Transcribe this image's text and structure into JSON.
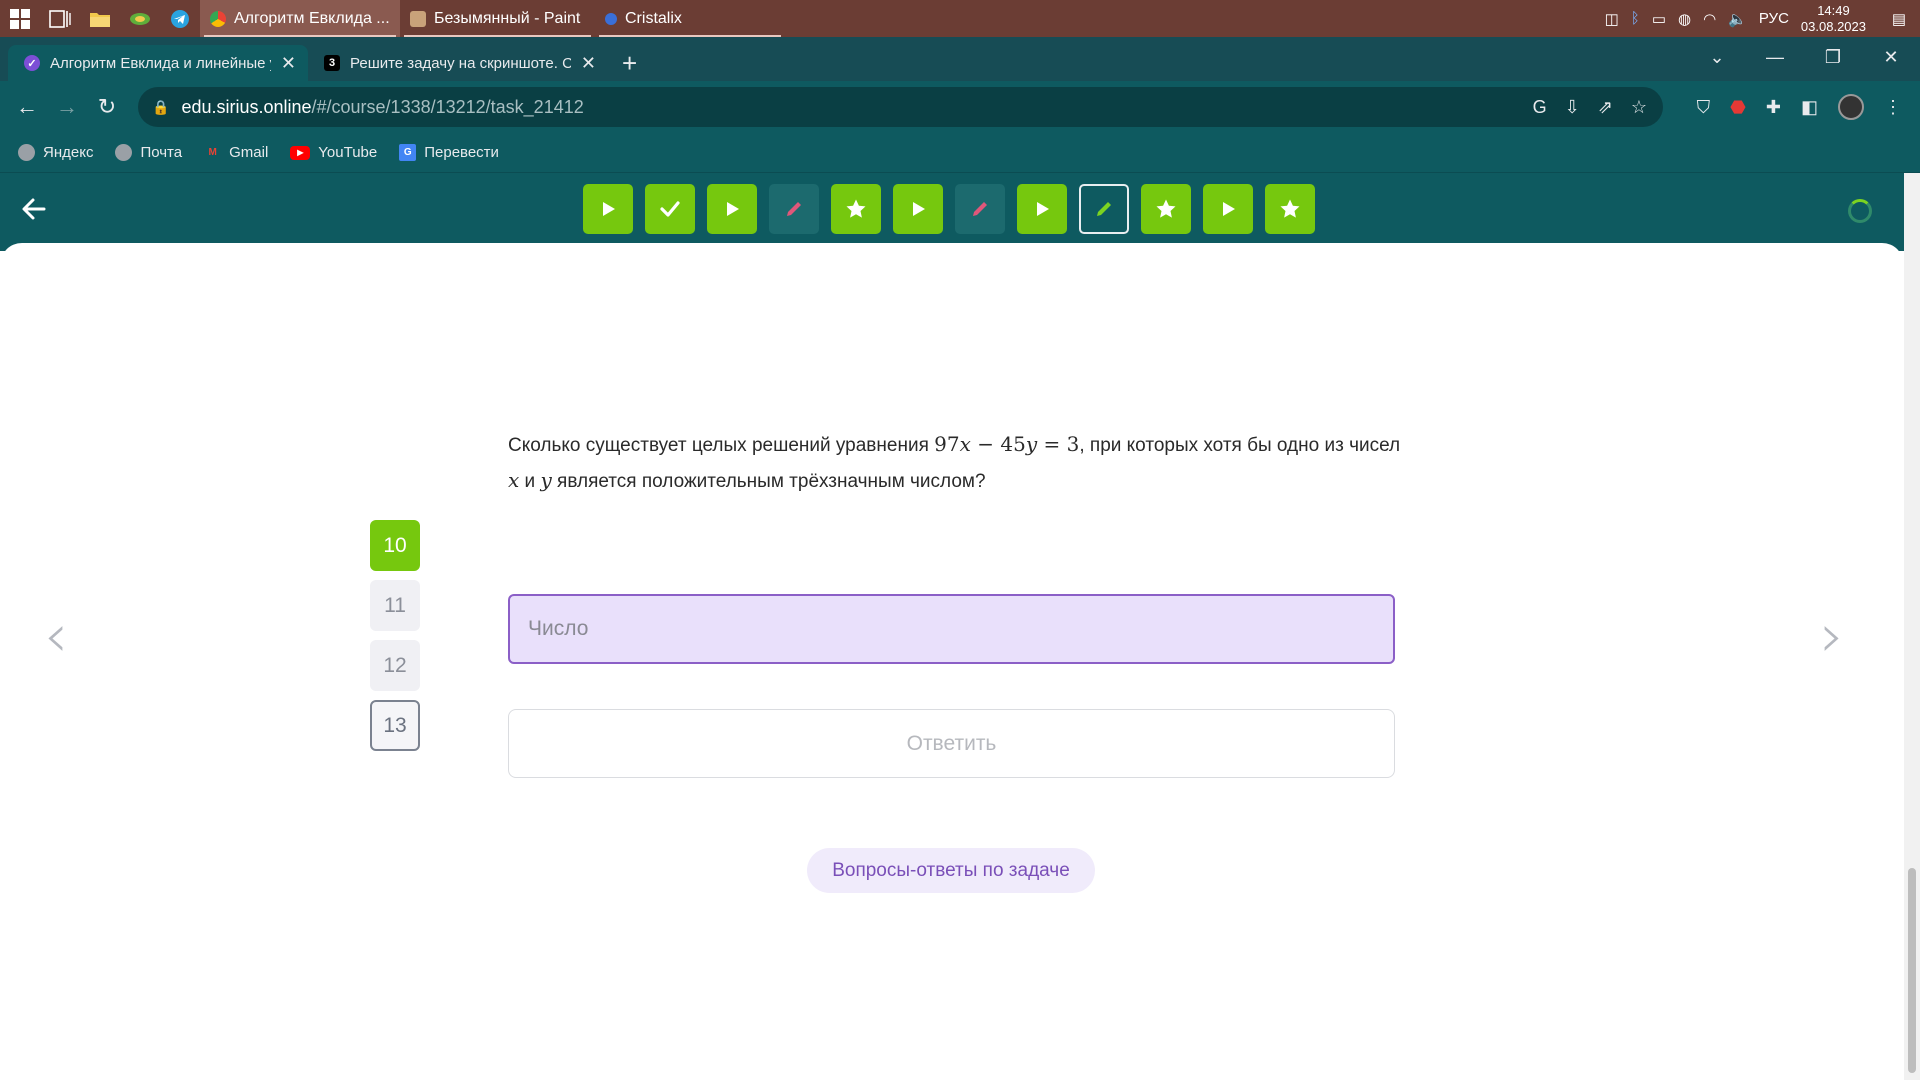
{
  "taskbar": {
    "items": [
      {
        "label": "Алгоритм Евклида ...",
        "icon": "chrome-icon"
      },
      {
        "label": "Безымянный - Paint",
        "icon": "paint-icon"
      },
      {
        "label": "Cristalix",
        "icon": "cristalix-icon"
      }
    ],
    "language": "РУС",
    "time": "14:49",
    "date": "03.08.2023"
  },
  "browser": {
    "tabs": [
      {
        "title": "Алгоритм Евклида и линейные у",
        "active": true
      },
      {
        "title": "Решите задачу на скриншоте. С",
        "active": false,
        "favicon_text": "3"
      }
    ],
    "url_host": "edu.sirius.online",
    "url_path": "/#/course/1338/13212/task_21412",
    "bookmarks": [
      {
        "label": "Яндекс"
      },
      {
        "label": "Почта"
      },
      {
        "label": "Gmail"
      },
      {
        "label": "YouTube"
      },
      {
        "label": "Перевести"
      }
    ]
  },
  "steps": [
    {
      "kind": "play",
      "state": "done"
    },
    {
      "kind": "check",
      "state": "done"
    },
    {
      "kind": "play",
      "state": "done"
    },
    {
      "kind": "pencil",
      "state": "todo"
    },
    {
      "kind": "star",
      "state": "done"
    },
    {
      "kind": "play",
      "state": "done"
    },
    {
      "kind": "pencil",
      "state": "todo"
    },
    {
      "kind": "play",
      "state": "done"
    },
    {
      "kind": "pencil",
      "state": "current"
    },
    {
      "kind": "star",
      "state": "done"
    },
    {
      "kind": "play",
      "state": "done"
    },
    {
      "kind": "star",
      "state": "done"
    }
  ],
  "task": {
    "question_part1": "Сколько существует целых решений уравнения ",
    "eq_97": "97",
    "eq_x": "x",
    "eq_minus": " − ",
    "eq_45": "45",
    "eq_y": "y",
    "eq_eq": " = ",
    "eq_3": "3",
    "question_part2": ", при которых хотя бы одно из чисел ",
    "var_x": "x",
    "and": " и ",
    "var_y": "y",
    "question_part3": " является положительным трёхзначным числом?",
    "answer_placeholder": "Число",
    "submit_label": "Ответить",
    "faq_label": "Вопросы-ответы по задаче"
  },
  "question_nav": [
    {
      "label": "10",
      "state": "done"
    },
    {
      "label": "11",
      "state": "normal"
    },
    {
      "label": "12",
      "state": "normal"
    },
    {
      "label": "13",
      "state": "selected"
    }
  ],
  "colors": {
    "accent_green": "#76c80e",
    "header_teal": "#0e5a60",
    "input_purple": "#e9e0fb",
    "faq_purple": "#7a4fb8"
  }
}
